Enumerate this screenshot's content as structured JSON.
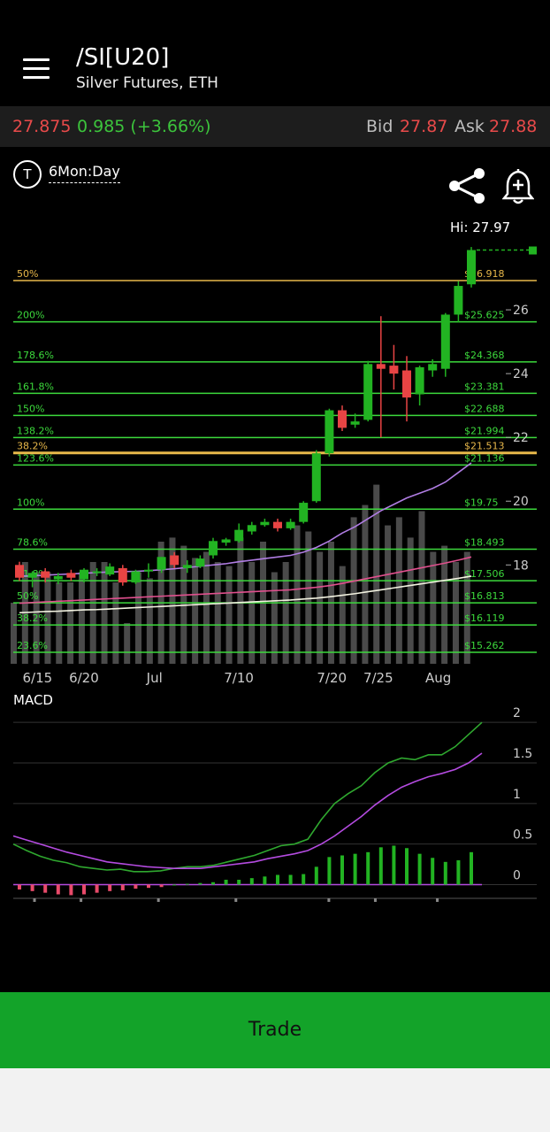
{
  "header": {
    "title": "/SI[U20]",
    "subtitle": "Silver Futures, ETH"
  },
  "quote": {
    "last": "27.875",
    "change": "0.985 (+3.66%)",
    "bid_label": "Bid",
    "bid": "27.87",
    "ask_label": "Ask",
    "ask": "27.88"
  },
  "toolbar": {
    "range": "6Mon:Day",
    "t_label": "T"
  },
  "chart": {
    "hi_label": "Hi: 27.97"
  },
  "trade": {
    "label": "Trade"
  },
  "colors": {
    "up": "#22b322",
    "down": "#e84444",
    "fib": "#3cd93c",
    "fib50": "#e8b84a",
    "macd": "#2fa82f",
    "signal": "#b44be0"
  },
  "chart_data": {
    "type": "candlestick",
    "price_axis": {
      "ticks": [
        18,
        20,
        22,
        24,
        26
      ],
      "range": [
        14.9,
        28.0
      ]
    },
    "x_ticks": [
      {
        "label": "6/15",
        "i": 1
      },
      {
        "label": "6/20",
        "i": 4
      },
      {
        "label": "Jul",
        "i": 9
      },
      {
        "label": "7/10",
        "i": 14
      },
      {
        "label": "7/20",
        "i": 20
      },
      {
        "label": "7/25",
        "i": 23
      },
      {
        "label": "Aug",
        "i": 27
      }
    ],
    "candles": [
      {
        "o": 18.0,
        "h": 18.1,
        "l": 17.5,
        "c": 17.6
      },
      {
        "o": 17.6,
        "h": 17.8,
        "l": 17.3,
        "c": 17.75
      },
      {
        "o": 17.8,
        "h": 17.9,
        "l": 17.45,
        "c": 17.6
      },
      {
        "o": 17.55,
        "h": 17.75,
        "l": 17.4,
        "c": 17.65
      },
      {
        "o": 17.75,
        "h": 17.85,
        "l": 17.5,
        "c": 17.6
      },
      {
        "o": 17.55,
        "h": 17.9,
        "l": 17.45,
        "c": 17.85
      },
      {
        "o": 17.75,
        "h": 17.9,
        "l": 17.65,
        "c": 17.8
      },
      {
        "o": 17.7,
        "h": 18.05,
        "l": 17.65,
        "c": 17.95
      },
      {
        "o": 17.9,
        "h": 18.0,
        "l": 17.35,
        "c": 17.45
      },
      {
        "o": 17.45,
        "h": 17.85,
        "l": 17.4,
        "c": 17.8
      },
      {
        "o": 17.8,
        "h": 18.05,
        "l": 17.6,
        "c": 17.85
      },
      {
        "o": 17.85,
        "h": 18.25,
        "l": 17.75,
        "c": 18.25
      },
      {
        "o": 18.3,
        "h": 18.4,
        "l": 17.9,
        "c": 18.0
      },
      {
        "o": 17.9,
        "h": 18.15,
        "l": 17.75,
        "c": 18.0
      },
      {
        "o": 17.95,
        "h": 18.3,
        "l": 17.9,
        "c": 18.2
      },
      {
        "o": 18.3,
        "h": 18.85,
        "l": 18.2,
        "c": 18.75
      },
      {
        "o": 18.7,
        "h": 18.85,
        "l": 18.6,
        "c": 18.8
      },
      {
        "o": 18.75,
        "h": 19.3,
        "l": 18.7,
        "c": 19.1
      },
      {
        "o": 19.05,
        "h": 19.35,
        "l": 18.95,
        "c": 19.25
      },
      {
        "o": 19.25,
        "h": 19.45,
        "l": 19.2,
        "c": 19.35
      },
      {
        "o": 19.35,
        "h": 19.45,
        "l": 19.05,
        "c": 19.15
      },
      {
        "o": 19.15,
        "h": 19.45,
        "l": 19.1,
        "c": 19.35
      },
      {
        "o": 19.35,
        "h": 20.0,
        "l": 19.3,
        "c": 19.95
      },
      {
        "o": 20.0,
        "h": 21.6,
        "l": 19.95,
        "c": 21.5
      },
      {
        "o": 21.5,
        "h": 22.9,
        "l": 21.4,
        "c": 22.85
      },
      {
        "o": 22.85,
        "h": 23.0,
        "l": 22.2,
        "c": 22.3
      },
      {
        "o": 22.4,
        "h": 22.75,
        "l": 22.3,
        "c": 22.5
      },
      {
        "o": 22.55,
        "h": 24.4,
        "l": 22.5,
        "c": 24.3
      },
      {
        "o": 24.3,
        "h": 25.8,
        "l": 22.0,
        "c": 24.15
      },
      {
        "o": 24.25,
        "h": 24.9,
        "l": 23.5,
        "c": 24.0
      },
      {
        "o": 24.1,
        "h": 24.55,
        "l": 22.5,
        "c": 23.25
      },
      {
        "o": 23.35,
        "h": 24.25,
        "l": 23.0,
        "c": 24.2
      },
      {
        "o": 24.1,
        "h": 24.45,
        "l": 23.9,
        "c": 24.3
      },
      {
        "o": 24.15,
        "h": 25.9,
        "l": 23.9,
        "c": 25.85
      },
      {
        "o": 25.85,
        "h": 26.9,
        "l": 25.6,
        "c": 26.75
      },
      {
        "o": 26.8,
        "h": 27.97,
        "l": 26.7,
        "c": 27.875
      }
    ],
    "volume_max": 100,
    "volume": [
      30,
      50,
      45,
      45,
      40,
      40,
      45,
      50,
      50,
      40,
      20,
      45,
      42,
      60,
      62,
      58,
      52,
      55,
      50,
      48,
      62,
      50,
      60,
      45,
      50,
      68,
      65,
      55,
      60,
      48,
      72,
      78,
      88,
      68,
      72,
      62,
      75,
      55,
      58,
      50,
      55
    ],
    "moving_averages": [
      {
        "name": "MA1",
        "color": "#b07de3",
        "values": [
          17.65,
          17.66,
          17.68,
          17.7,
          17.72,
          17.74,
          17.76,
          17.78,
          17.79,
          17.8,
          17.82,
          17.85,
          17.88,
          17.92,
          17.96,
          18.0,
          18.04,
          18.1,
          18.15,
          18.2,
          18.25,
          18.3,
          18.4,
          18.55,
          18.75,
          19.0,
          19.2,
          19.45,
          19.7,
          19.9,
          20.1,
          20.25,
          20.4,
          20.6,
          20.9,
          21.2
        ]
      },
      {
        "name": "MA2",
        "color": "#e0508e",
        "values": [
          16.8,
          16.82,
          16.84,
          16.86,
          16.88,
          16.9,
          16.92,
          16.94,
          16.96,
          16.98,
          17.0,
          17.02,
          17.04,
          17.06,
          17.08,
          17.1,
          17.12,
          17.14,
          17.16,
          17.18,
          17.2,
          17.22,
          17.26,
          17.3,
          17.35,
          17.42,
          17.5,
          17.58,
          17.66,
          17.74,
          17.82,
          17.9,
          17.98,
          18.06,
          18.15,
          18.25
        ]
      },
      {
        "name": "MA3",
        "color": "#f2f2e0",
        "values": [
          16.5,
          16.52,
          16.54,
          16.55,
          16.57,
          16.59,
          16.6,
          16.62,
          16.64,
          16.66,
          16.68,
          16.7,
          16.72,
          16.74,
          16.76,
          16.78,
          16.8,
          16.82,
          16.84,
          16.86,
          16.88,
          16.9,
          16.93,
          16.96,
          17.0,
          17.05,
          17.1,
          17.16,
          17.22,
          17.28,
          17.34,
          17.4,
          17.46,
          17.52,
          17.58,
          17.65
        ]
      }
    ],
    "fib_levels": [
      {
        "pct": "50%",
        "price": "$26.918",
        "v": 26.918,
        "color": "#e8b84a"
      },
      {
        "pct": "200%",
        "price": "$25.625",
        "v": 25.625,
        "color": "#3cd93c"
      },
      {
        "pct": "178.6%",
        "price": "$24.368",
        "v": 24.368,
        "color": "#3cd93c"
      },
      {
        "pct": "161.8%",
        "price": "$23.381",
        "v": 23.381,
        "color": "#3cd93c"
      },
      {
        "pct": "150%",
        "price": "$22.688",
        "v": 22.688,
        "color": "#3cd93c"
      },
      {
        "pct": "138.2%",
        "price": "$21.994",
        "v": 21.994,
        "color": "#3cd93c"
      },
      {
        "pct": "38.2%",
        "price": "$21.513",
        "v": 21.513,
        "color": "#e8b84a"
      },
      {
        "pct": "123.6%",
        "price": "$21.136",
        "v": 21.136,
        "color": "#3cd93c"
      },
      {
        "pct": "100%",
        "price": "$19.75",
        "v": 19.75,
        "color": "#3cd93c"
      },
      {
        "pct": "78.6%",
        "price": "$18.493",
        "v": 18.493,
        "color": "#3cd93c"
      },
      {
        "pct": "61.8%",
        "price": "$17.506",
        "v": 17.506,
        "color": "#3cd93c"
      },
      {
        "pct": "50%",
        "price": "$16.813",
        "v": 16.813,
        "color": "#3cd93c"
      },
      {
        "pct": "38.2%",
        "price": "$16.119",
        "v": 16.119,
        "color": "#3cd93c"
      },
      {
        "pct": "23.6%",
        "price": "$15.262",
        "v": 15.262,
        "color": "#3cd93c"
      }
    ],
    "macd": {
      "title": "MACD",
      "ticks": [
        0,
        0.5,
        1,
        1.5,
        2
      ],
      "range": [
        -0.3,
        2.1
      ],
      "macd_line": [
        0.5,
        0.42,
        0.35,
        0.3,
        0.27,
        0.22,
        0.2,
        0.18,
        0.19,
        0.16,
        0.16,
        0.17,
        0.2,
        0.22,
        0.22,
        0.24,
        0.28,
        0.32,
        0.36,
        0.42,
        0.48,
        0.5,
        0.56,
        0.8,
        1.0,
        1.12,
        1.22,
        1.38,
        1.5,
        1.56,
        1.54,
        1.6,
        1.6,
        1.7,
        1.85,
        2.0
      ],
      "signal_line": [
        0.6,
        0.55,
        0.5,
        0.45,
        0.4,
        0.36,
        0.32,
        0.28,
        0.26,
        0.24,
        0.22,
        0.21,
        0.2,
        0.2,
        0.2,
        0.22,
        0.24,
        0.26,
        0.28,
        0.32,
        0.35,
        0.38,
        0.42,
        0.5,
        0.6,
        0.72,
        0.84,
        0.98,
        1.1,
        1.2,
        1.27,
        1.33,
        1.37,
        1.42,
        1.5,
        1.62
      ],
      "histogram": [
        -0.06,
        -0.08,
        -0.1,
        -0.12,
        -0.13,
        -0.12,
        -0.1,
        -0.08,
        -0.07,
        -0.05,
        -0.04,
        -0.03,
        0,
        0.01,
        0.02,
        0.03,
        0.06,
        0.06,
        0.08,
        0.1,
        0.12,
        0.12,
        0.13,
        0.22,
        0.34,
        0.36,
        0.38,
        0.4,
        0.46,
        0.48,
        0.45,
        0.38,
        0.33,
        0.28,
        0.3,
        0.4
      ]
    }
  }
}
